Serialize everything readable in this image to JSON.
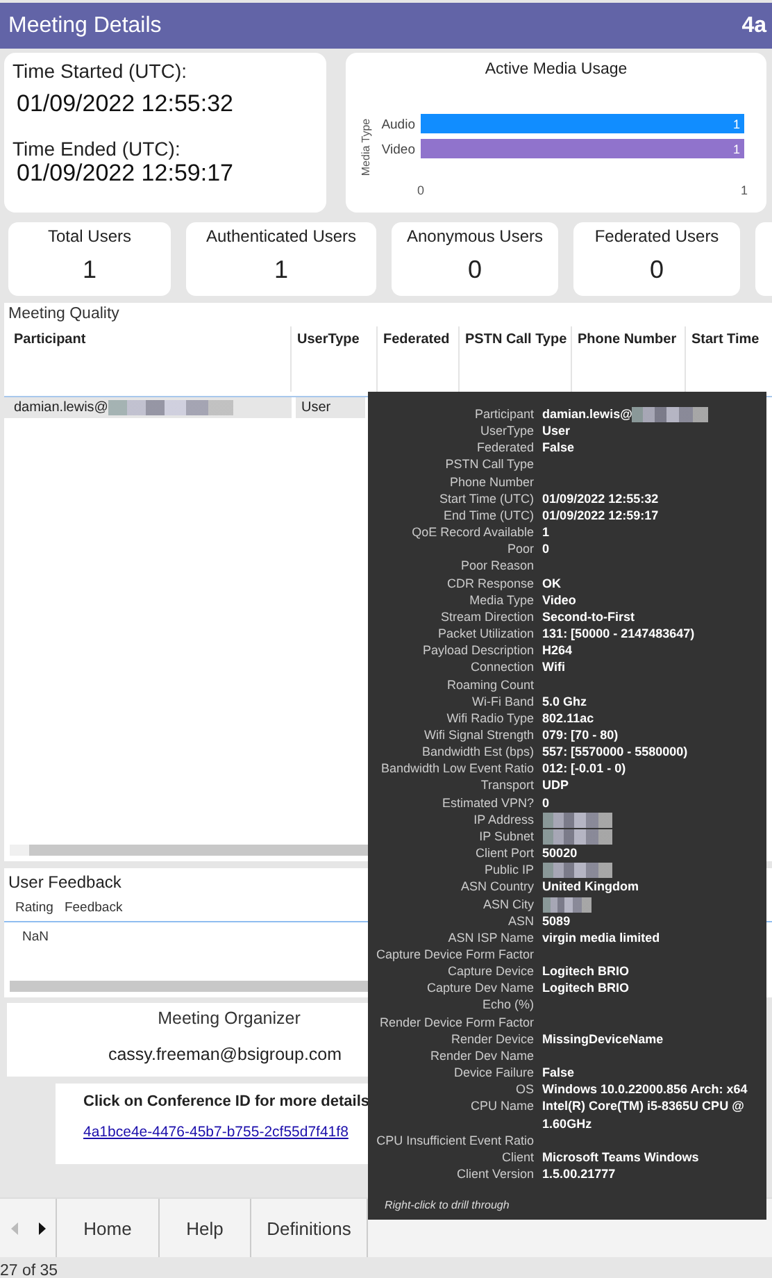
{
  "header": {
    "title": "Meeting Details",
    "badge": "4a"
  },
  "times": {
    "started_label": "Time Started (UTC):",
    "started": "01/09/2022 12:55:32",
    "ended_label": "Time Ended (UTC):",
    "ended": "01/09/2022 12:59:17"
  },
  "media_usage": {
    "chart_data": {
      "type": "bar",
      "orientation": "horizontal",
      "title": "Active Media Usage",
      "ylabel": "Media Type",
      "categories": [
        "Audio",
        "Video"
      ],
      "stacked": true,
      "data_labels": true,
      "xlim": [
        0,
        1
      ],
      "xticks": [
        0,
        1
      ],
      "series": [
        {
          "color": "#118dff",
          "values": [
            1,
            null
          ]
        },
        {
          "color": "#9073cc",
          "values": [
            null,
            1
          ]
        }
      ]
    }
  },
  "kpis": [
    {
      "label": "Total Users",
      "value": "1"
    },
    {
      "label": "Authenticated Users",
      "value": "1"
    },
    {
      "label": "Anonymous Users",
      "value": "0"
    },
    {
      "label": "Federated Users",
      "value": "0"
    }
  ],
  "meeting_quality": {
    "title": "Meeting Quality",
    "columns": [
      "Participant",
      "UserType",
      "Federated",
      "PSTN Call Type",
      "Phone Number",
      "Start Time"
    ],
    "rows": [
      {
        "participant": "damian.lewis@",
        "redacted": true,
        "user_type": "User"
      }
    ]
  },
  "user_feedback": {
    "title": "User Feedback",
    "columns": [
      "Rating",
      "Feedback"
    ],
    "rows": [
      [
        "NaN"
      ]
    ]
  },
  "organizer": {
    "title": "Meeting Organizer",
    "email": "cassy.freeman@bsigroup.com"
  },
  "conference": {
    "hint": "Click on Conference ID for more details",
    "link": "4a1bce4e-4476-45b7-b755-2cf55d7f41f8"
  },
  "page_tabs": [
    {
      "label": "Home"
    },
    {
      "label": "Help"
    },
    {
      "label": "Definitions"
    }
  ],
  "status_bar": {
    "page": "27 of 35"
  },
  "tooltip": {
    "rows": [
      {
        "label": "Participant",
        "value": "damian.lewis@",
        "redacted": true
      },
      {
        "label": "UserType",
        "value": "User"
      },
      {
        "label": "Federated",
        "value": "False"
      },
      {
        "label": "PSTN Call Type"
      },
      {
        "label": "Phone Number"
      },
      {
        "label": "Start Time (UTC)",
        "value": "01/09/2022 12:55:32"
      },
      {
        "label": "End Time (UTC)",
        "value": "01/09/2022 12:59:17"
      },
      {
        "label": "QoE Record Available",
        "value": "1"
      },
      {
        "label": "Poor",
        "value": "0"
      },
      {
        "label": "Poor Reason"
      },
      {
        "label": "CDR Response",
        "value": "OK"
      },
      {
        "label": "Media Type",
        "value": "Video"
      },
      {
        "label": "Stream Direction",
        "value": "Second-to-First"
      },
      {
        "label": "Packet Utilization",
        "value": "131: [50000 - 2147483647)"
      },
      {
        "label": "Payload Description",
        "value": "H264"
      },
      {
        "label": "Connection",
        "value": "Wifi"
      },
      {
        "label": "Roaming Count"
      },
      {
        "label": "Wi-Fi Band",
        "value": "5.0 Ghz"
      },
      {
        "label": "Wifi Radio Type",
        "value": "802.11ac"
      },
      {
        "label": "Wifi Signal Strength",
        "value": "079: [70 - 80)"
      },
      {
        "label": "Bandwidth Est (bps)",
        "value": "557: [5570000 - 5580000)"
      },
      {
        "label": "Bandwidth Low Event Ratio",
        "value": "012: [-0.01 - 0)"
      },
      {
        "label": "Transport",
        "value": "UDP"
      },
      {
        "label": "Estimated VPN?",
        "value": "0"
      },
      {
        "label": "IP Address",
        "redacted": true
      },
      {
        "label": "IP Subnet",
        "redacted": true
      },
      {
        "label": "Client Port",
        "value": "50020"
      },
      {
        "label": "Public IP",
        "redacted": true
      },
      {
        "label": "ASN Country",
        "value": "United Kingdom"
      },
      {
        "label": "ASN City",
        "redacted": true
      },
      {
        "label": "ASN",
        "value": "5089"
      },
      {
        "label": "ASN ISP Name",
        "value": "virgin media limited"
      },
      {
        "label": "Capture Device Form Factor"
      },
      {
        "label": "Capture Device",
        "value": "Logitech BRIO"
      },
      {
        "label": "Capture Dev Name",
        "value": "Logitech BRIO"
      },
      {
        "label": "Echo (%)"
      },
      {
        "label": "Render Device Form Factor"
      },
      {
        "label": "Render Device",
        "value": "MissingDeviceName"
      },
      {
        "label": "Render Dev Name"
      },
      {
        "label": "Device Failure",
        "value": "False"
      },
      {
        "label": "OS",
        "value": "Windows 10.0.22000.856 Arch: x64"
      },
      {
        "label": "CPU Name",
        "value": "Intel(R) Core(TM) i5-8365U CPU @ 1.60GHz"
      },
      {
        "label": "CPU Insufficient Event Ratio"
      },
      {
        "label": "Client",
        "value": "Microsoft Teams Windows"
      },
      {
        "label": "Client Version",
        "value": "1.5.00.21777"
      }
    ],
    "footer": "Right-click to drill through"
  }
}
